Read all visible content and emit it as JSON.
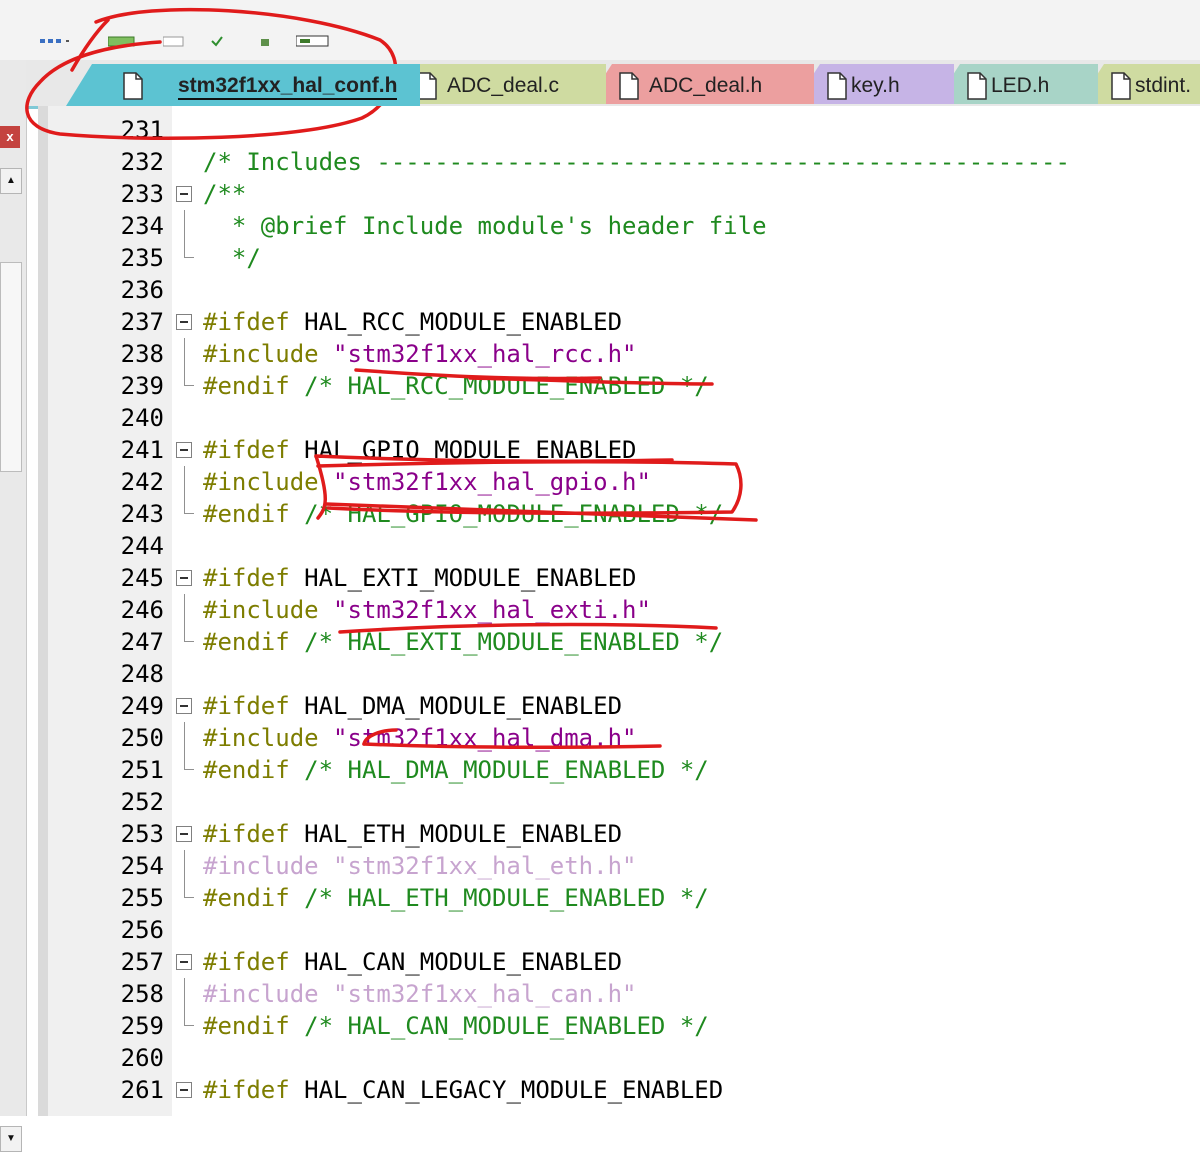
{
  "tabs": [
    {
      "label": "stm32f1xx_hal_conf.h",
      "active": true,
      "color": "#5cc3d2"
    },
    {
      "label": "ADC_deal.c",
      "active": false,
      "color": "#cfdba1"
    },
    {
      "label": "ADC_deal.h",
      "active": false,
      "color": "#ec9f9f"
    },
    {
      "label": "key.h",
      "active": false,
      "color": "#c6b4e6"
    },
    {
      "label": "LED.h",
      "active": false,
      "color": "#a8d4c7"
    },
    {
      "label": "stdint.",
      "active": false,
      "color": "#cfdba1"
    }
  ],
  "sidebar": {
    "close_label": "x",
    "scroll_up": "▲",
    "scroll_down": "▼"
  },
  "code_lines": [
    {
      "num": "231",
      "parts": []
    },
    {
      "num": "232",
      "parts": [
        {
          "t": "/* Includes ------------------------------------------------",
          "c": "comment"
        }
      ]
    },
    {
      "num": "233",
      "parts": [
        {
          "t": "/**",
          "c": "comment"
        }
      ]
    },
    {
      "num": "234",
      "parts": [
        {
          "t": "  * @brief Include module's header file",
          "c": "comment"
        }
      ]
    },
    {
      "num": "235",
      "parts": [
        {
          "t": "  */",
          "c": "comment"
        }
      ]
    },
    {
      "num": "236",
      "parts": []
    },
    {
      "num": "237",
      "parts": [
        {
          "t": "#ifdef",
          "c": "pre"
        },
        {
          "t": " HAL_RCC_MODULE_ENABLED",
          "c": "def"
        }
      ]
    },
    {
      "num": "238",
      "parts": [
        {
          "t": "#include",
          "c": "pre"
        },
        {
          "t": " \"stm32f1xx_hal_rcc.h\"",
          "c": "str"
        }
      ]
    },
    {
      "num": "239",
      "parts": [
        {
          "t": "#endif",
          "c": "pre"
        },
        {
          "t": " /* HAL_RCC_MODULE_ENABLED */",
          "c": "comment"
        }
      ]
    },
    {
      "num": "240",
      "parts": []
    },
    {
      "num": "241",
      "parts": [
        {
          "t": "#ifdef",
          "c": "pre"
        },
        {
          "t": " HAL_GPIO_MODULE_ENABLED",
          "c": "def"
        }
      ]
    },
    {
      "num": "242",
      "parts": [
        {
          "t": "#include",
          "c": "pre"
        },
        {
          "t": " \"stm32f1xx_hal_gpio.h\"",
          "c": "str"
        }
      ]
    },
    {
      "num": "243",
      "parts": [
        {
          "t": "#endif",
          "c": "pre"
        },
        {
          "t": " /* HAL_GPIO_MODULE_ENABLED */",
          "c": "comment"
        }
      ]
    },
    {
      "num": "244",
      "parts": []
    },
    {
      "num": "245",
      "parts": [
        {
          "t": "#ifdef",
          "c": "pre"
        },
        {
          "t": " HAL_EXTI_MODULE_ENABLED",
          "c": "def"
        }
      ]
    },
    {
      "num": "246",
      "parts": [
        {
          "t": "#include",
          "c": "pre"
        },
        {
          "t": " \"stm32f1xx_hal_exti.h\"",
          "c": "str"
        }
      ]
    },
    {
      "num": "247",
      "parts": [
        {
          "t": "#endif",
          "c": "pre"
        },
        {
          "t": " /* HAL_EXTI_MODULE_ENABLED */",
          "c": "comment"
        }
      ]
    },
    {
      "num": "248",
      "parts": []
    },
    {
      "num": "249",
      "parts": [
        {
          "t": "#ifdef",
          "c": "pre"
        },
        {
          "t": " HAL_DMA_MODULE_ENABLED",
          "c": "def"
        }
      ]
    },
    {
      "num": "250",
      "parts": [
        {
          "t": "#include",
          "c": "pre"
        },
        {
          "t": " \"stm32f1xx_hal_dma.h\"",
          "c": "str"
        }
      ]
    },
    {
      "num": "251",
      "parts": [
        {
          "t": "#endif",
          "c": "pre"
        },
        {
          "t": " /* HAL_DMA_MODULE_ENABLED */",
          "c": "comment"
        }
      ]
    },
    {
      "num": "252",
      "parts": []
    },
    {
      "num": "253",
      "parts": [
        {
          "t": "#ifdef",
          "c": "pre"
        },
        {
          "t": " HAL_ETH_MODULE_ENABLED",
          "c": "def"
        }
      ]
    },
    {
      "num": "254",
      "parts": [
        {
          "t": "#include",
          "c": "pre-dim"
        },
        {
          "t": " \"stm32f1xx_hal_eth.h\"",
          "c": "str-dim"
        }
      ]
    },
    {
      "num": "255",
      "parts": [
        {
          "t": "#endif",
          "c": "pre"
        },
        {
          "t": " /* HAL_ETH_MODULE_ENABLED */",
          "c": "comment"
        }
      ]
    },
    {
      "num": "256",
      "parts": []
    },
    {
      "num": "257",
      "parts": [
        {
          "t": "#ifdef",
          "c": "pre"
        },
        {
          "t": " HAL_CAN_MODULE_ENABLED",
          "c": "def"
        }
      ]
    },
    {
      "num": "258",
      "parts": [
        {
          "t": "#include",
          "c": "pre-dim"
        },
        {
          "t": " \"stm32f1xx_hal_can.h\"",
          "c": "str-dim"
        }
      ]
    },
    {
      "num": "259",
      "parts": [
        {
          "t": "#endif",
          "c": "pre"
        },
        {
          "t": " /* HAL_CAN_MODULE_ENABLED */",
          "c": "comment"
        }
      ]
    },
    {
      "num": "260",
      "parts": []
    },
    {
      "num": "261",
      "parts": [
        {
          "t": "#ifdef",
          "c": "pre"
        },
        {
          "t": " HAL_CAN_LEGACY_MODULE_ENABLED",
          "c": "def"
        }
      ]
    }
  ],
  "colors": {
    "annotation": "#e01b1b",
    "active_tab": "#5cc3d2"
  }
}
